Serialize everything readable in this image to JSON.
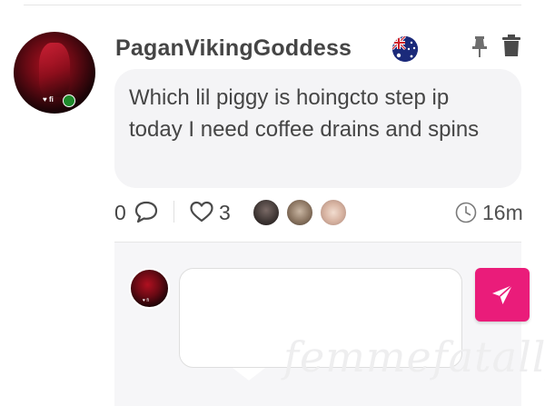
{
  "post": {
    "username": "PaganVikingGoddess",
    "country_flag": "australia-flag-icon",
    "avatar_watermark": "♥ fi",
    "online": true,
    "message": "Which lil piggy is hoingcto step ip today I need coffee drains and spins",
    "comment_count": "0",
    "like_count": "3",
    "time_ago": "16m"
  },
  "actions": {
    "pin_icon": "pin-icon",
    "delete_icon": "trash-icon"
  },
  "reply": {
    "avatar_watermark": "♥ fi",
    "input_value": "",
    "send_icon": "paper-plane-icon",
    "send_color": "#ea1c7a"
  },
  "watermark_text": "femmefatally"
}
